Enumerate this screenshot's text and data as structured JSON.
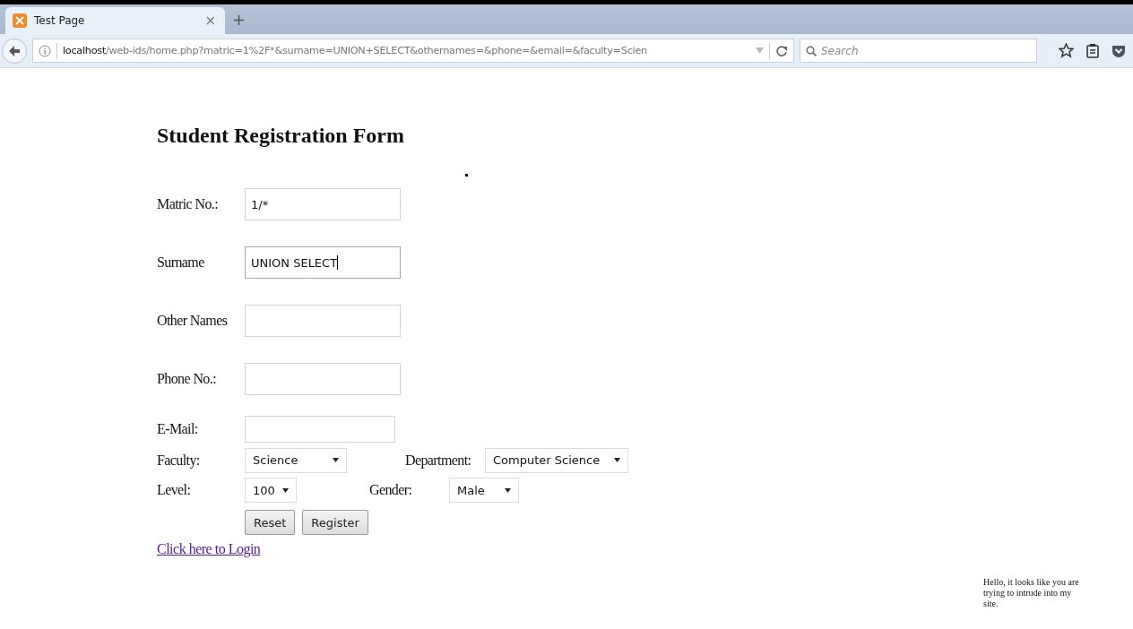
{
  "browser": {
    "tab": {
      "title": "Test Page",
      "close": "×"
    },
    "new_tab": "+",
    "url": {
      "host": "localhost",
      "path": "/web-ids/home.php?matric=1%2F*&surname=UNION+SELECT&othernames=&phone=&email=&faculty=Scien"
    },
    "search": {
      "placeholder": "Search"
    }
  },
  "form": {
    "title": "Student Registration Form",
    "text_fields": [
      {
        "label": "Matric No.:",
        "value": "1/*",
        "focused": false
      },
      {
        "label": "Surname",
        "value": "UNION SELECT",
        "focused": true
      },
      {
        "label": "Other Names",
        "focused": false
      },
      {
        "label": "Phone No.:",
        "focused": false
      },
      {
        "label": "E-Mail:",
        "focused": false
      }
    ],
    "select_rows": [
      [
        {
          "label": "Faculty:",
          "value": "Science"
        },
        {
          "label": "Department:",
          "value": "Computer Science"
        }
      ],
      [
        {
          "label": "Level:",
          "value": "100"
        },
        {
          "label": "Gender:",
          "value": "Male"
        }
      ]
    ],
    "buttons": [
      "Reset",
      "Register"
    ],
    "link": "Click here to Login"
  },
  "notice": "Hello, it looks like you are trying to intrude into my site."
}
